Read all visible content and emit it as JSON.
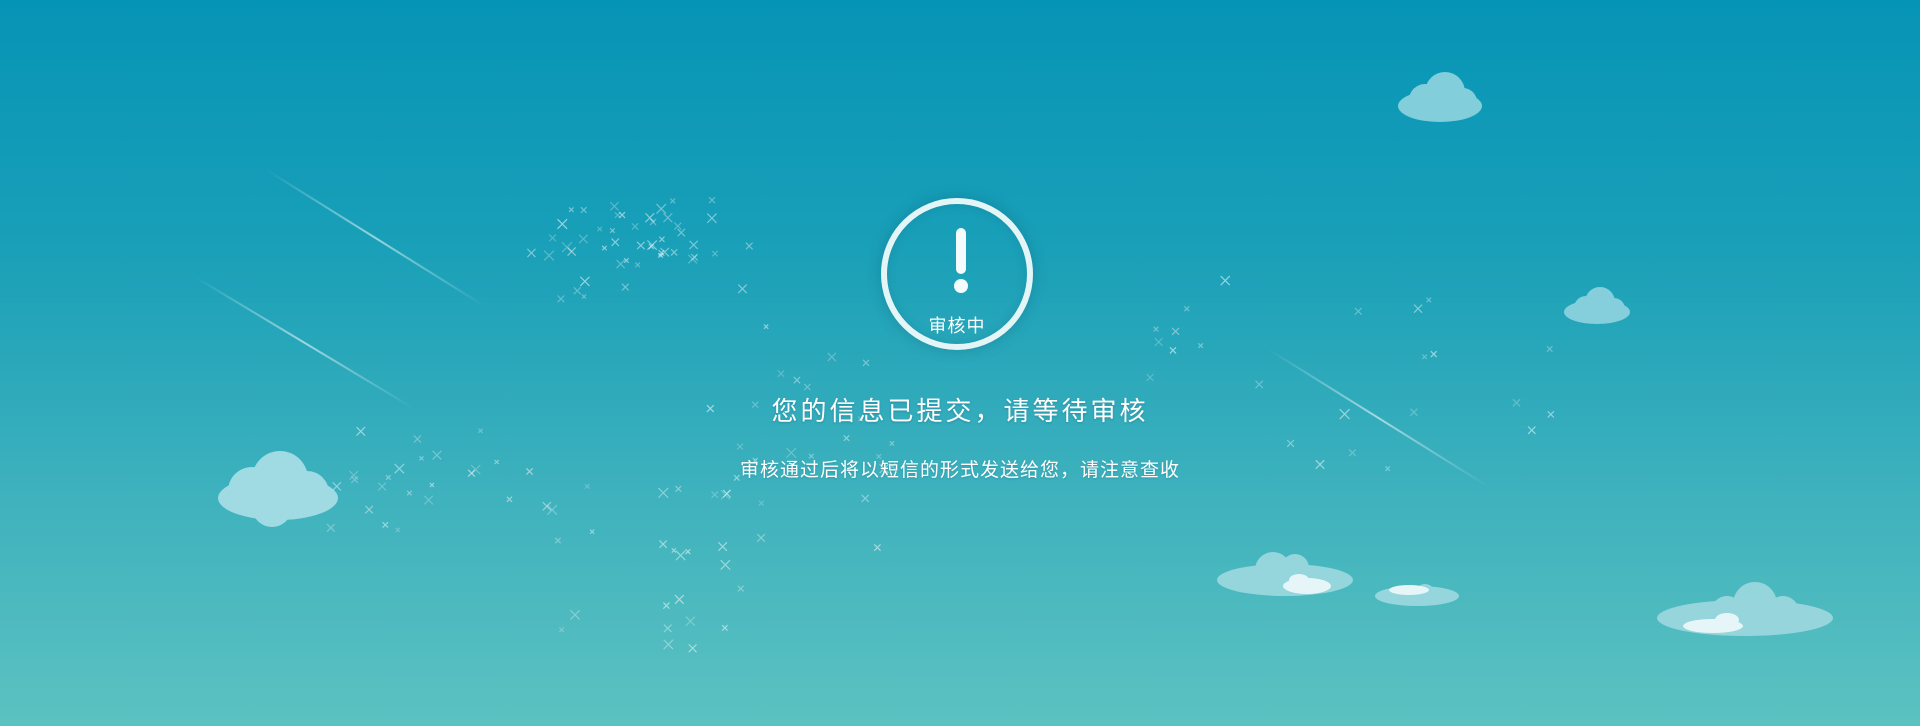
{
  "status": {
    "icon": "exclamation-icon",
    "label": "审核中"
  },
  "message": {
    "title": "您的信息已提交，请等待审核",
    "subtitle": "审核通过后将以短信的形式发送给您，请注意查收"
  },
  "colors": {
    "background_top": "#0694b6",
    "background_bottom": "#5cc2c1",
    "ring": "#e4f5f7",
    "text": "#ffffff"
  }
}
